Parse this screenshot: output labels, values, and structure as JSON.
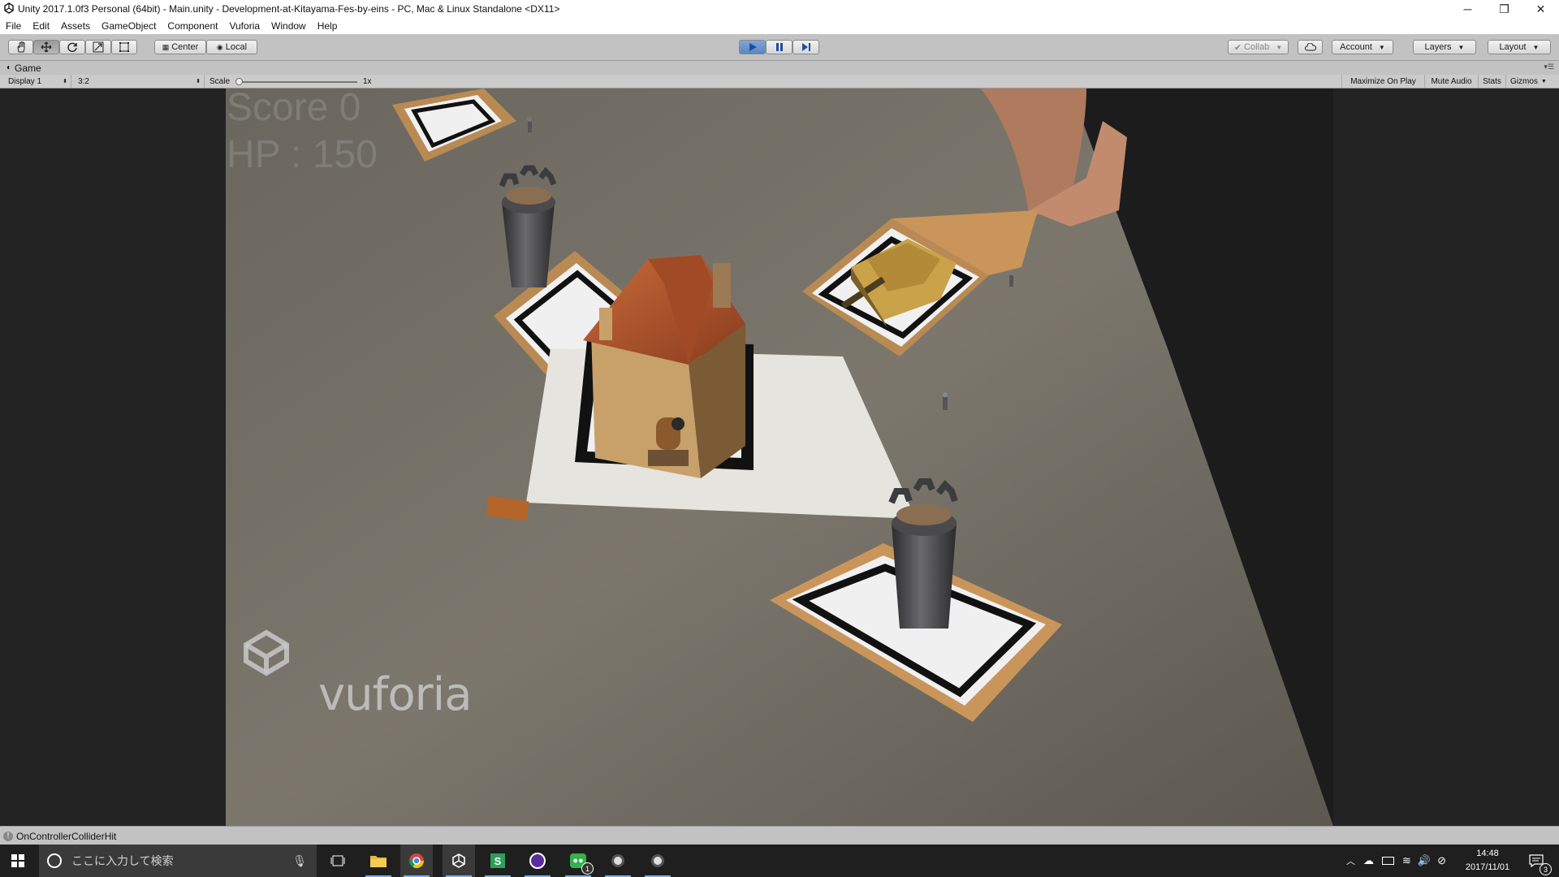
{
  "window": {
    "title": "Unity 2017.1.0f3 Personal (64bit) - Main.unity - Development-at-Kitayama-Fes-by-eins - PC, Mac & Linux Standalone <DX11>",
    "minimize": "─",
    "restore": "❐",
    "close": "✕"
  },
  "menubar": [
    "File",
    "Edit",
    "Assets",
    "GameObject",
    "Component",
    "Vuforia",
    "Window",
    "Help"
  ],
  "toolbar": {
    "tools": [
      "hand-icon",
      "move-icon",
      "rotate-icon",
      "scale-icon",
      "rect-icon"
    ],
    "pivot": "Center",
    "space": "Local",
    "collab": "Collab",
    "account": "Account",
    "layers": "Layers",
    "layout": "Layout"
  },
  "game_tab": {
    "label": "Game",
    "display": "Display 1",
    "aspect": "3:2",
    "scale_label": "Scale",
    "scale_value": "1x",
    "scale_level": 0.0,
    "maximize": "Maximize On Play",
    "mute": "Mute Audio",
    "stats": "Stats",
    "gizmos": "Gizmos"
  },
  "hud": {
    "score": "Score 0",
    "hp": "HP : 150"
  },
  "watermark": "vuforia",
  "status": {
    "message": "OnControllerColliderHit"
  },
  "taskbar": {
    "search_placeholder": "ここに入力して検索",
    "time": "14:48",
    "date": "2017/11/01",
    "line_badge": "1",
    "notification_badge": "3"
  },
  "colors": {
    "accent": "#5b86c2",
    "taskbar": "#1f1f1f",
    "editor": "#c2c2c2"
  }
}
